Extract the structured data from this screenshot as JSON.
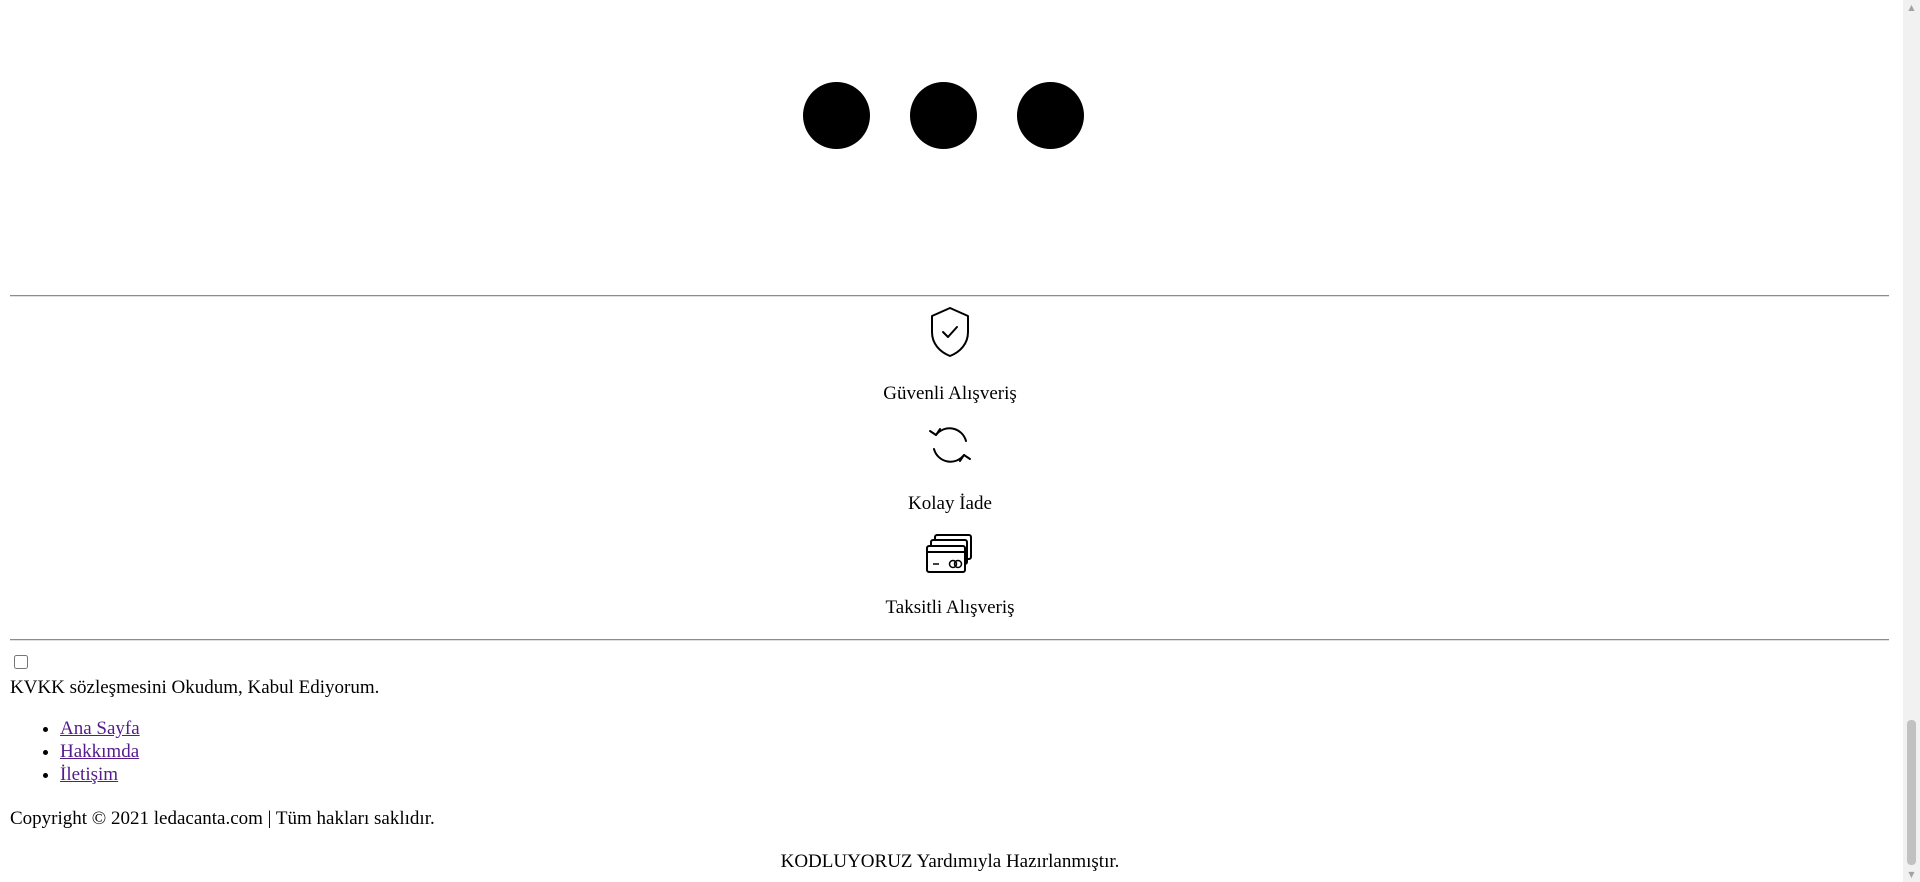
{
  "slider": {
    "dots": [
      "dot-1",
      "dot-2",
      "dot-3"
    ]
  },
  "features": [
    {
      "icon": "shield-check-icon",
      "label": "Güvenli Alışveriş"
    },
    {
      "icon": "refresh-icon",
      "label": "Kolay İade"
    },
    {
      "icon": "credit-cards-icon",
      "label": "Taksitli Alışveriş"
    }
  ],
  "kvkk": {
    "label": "KVKK sözleşmesini Okudum, Kabul Ediyorum.",
    "checked": false
  },
  "nav_links": [
    "Ana Sayfa",
    "Hakkımda",
    "İletişim"
  ],
  "footer": {
    "copyright": "Copyright © 2021 ledacanta.com | Tüm hakları saklıdır.",
    "credit": "KODLUYORUZ Yardımıyla Hazırlanmıştır."
  },
  "scrollbar": {
    "up_arrow": "scroll-up-icon",
    "down_arrow": "scroll-down-icon"
  }
}
